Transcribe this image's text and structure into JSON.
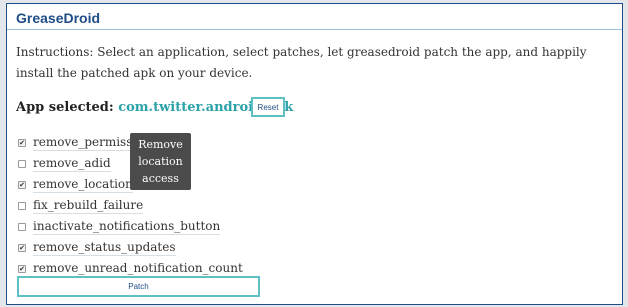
{
  "app": {
    "title": "GreaseDroid"
  },
  "instructions": {
    "text": "Instructions: Select an application, select patches, let greasedroid patch the app, and happily install the patched apk on your device."
  },
  "selection": {
    "label": "App selected:",
    "app_name": "com.twitter.android.apk",
    "reset_label": "Reset"
  },
  "patches": [
    {
      "label": "remove_permissions",
      "checked": true
    },
    {
      "label": "remove_adid",
      "checked": false
    },
    {
      "label": "remove_location",
      "checked": true
    },
    {
      "label": "fix_rebuild_failure",
      "checked": false
    },
    {
      "label": "inactivate_notifications_button",
      "checked": false
    },
    {
      "label": "remove_status_updates",
      "checked": true
    },
    {
      "label": "remove_unread_notification_count",
      "checked": true
    }
  ],
  "tooltip": {
    "line1": "Remove",
    "line2": "location",
    "line3": "access"
  },
  "actions": {
    "patch_label": "Patch"
  },
  "colors": {
    "title": "#1f4d88",
    "app_name": "#2aa2a8",
    "button_border": "#5dc0c4",
    "tooltip_bg": "#4b4b4b"
  },
  "icons": {
    "checked": "check-mark-icon"
  }
}
